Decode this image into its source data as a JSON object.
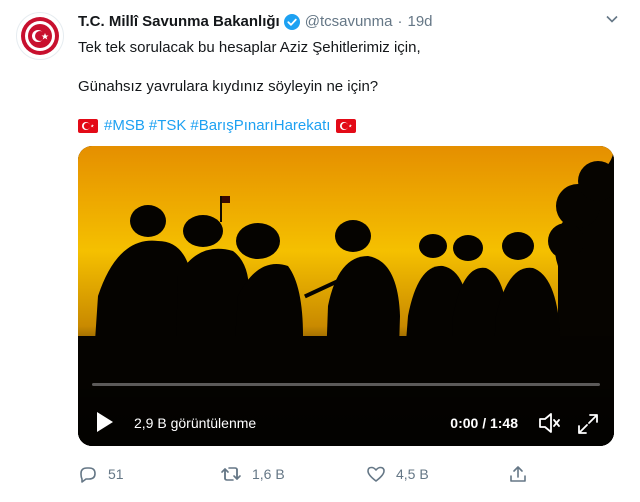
{
  "tweet": {
    "author_name": "T.C. Millî Savunma Bakanlığı",
    "handle": "@tcsavunma",
    "separator": "·",
    "time": "19d",
    "line1": "Tek tek sorulacak bu hesaplar Aziz Şehitlerimiz için,",
    "line2": "Günahsız yavrulara kıydınız söyleyin ne için?",
    "hashtags": [
      "#MSB",
      "#TSK",
      "#BarışPınarıHarekatı"
    ]
  },
  "video": {
    "views": "2,9 B görüntülenme",
    "time": "0:00 / 1:48",
    "progress": 0.0
  },
  "actions": {
    "replies": "51",
    "retweets": "1,6 B",
    "likes": "4,5 B"
  },
  "colors": {
    "accent": "#1da1f2",
    "muted": "#657786",
    "flag_red": "#e30a17",
    "sky_top": "#f0a800",
    "sky_bottom": "#f5c500"
  },
  "icons": {
    "menu": "chevron-down-icon",
    "verified": "verified-badge-icon",
    "reply": "reply-icon",
    "retweet": "retweet-icon",
    "like": "heart-icon",
    "share": "share-icon",
    "play": "play-icon",
    "volume": "volume-icon",
    "fullscreen": "fullscreen-icon"
  }
}
